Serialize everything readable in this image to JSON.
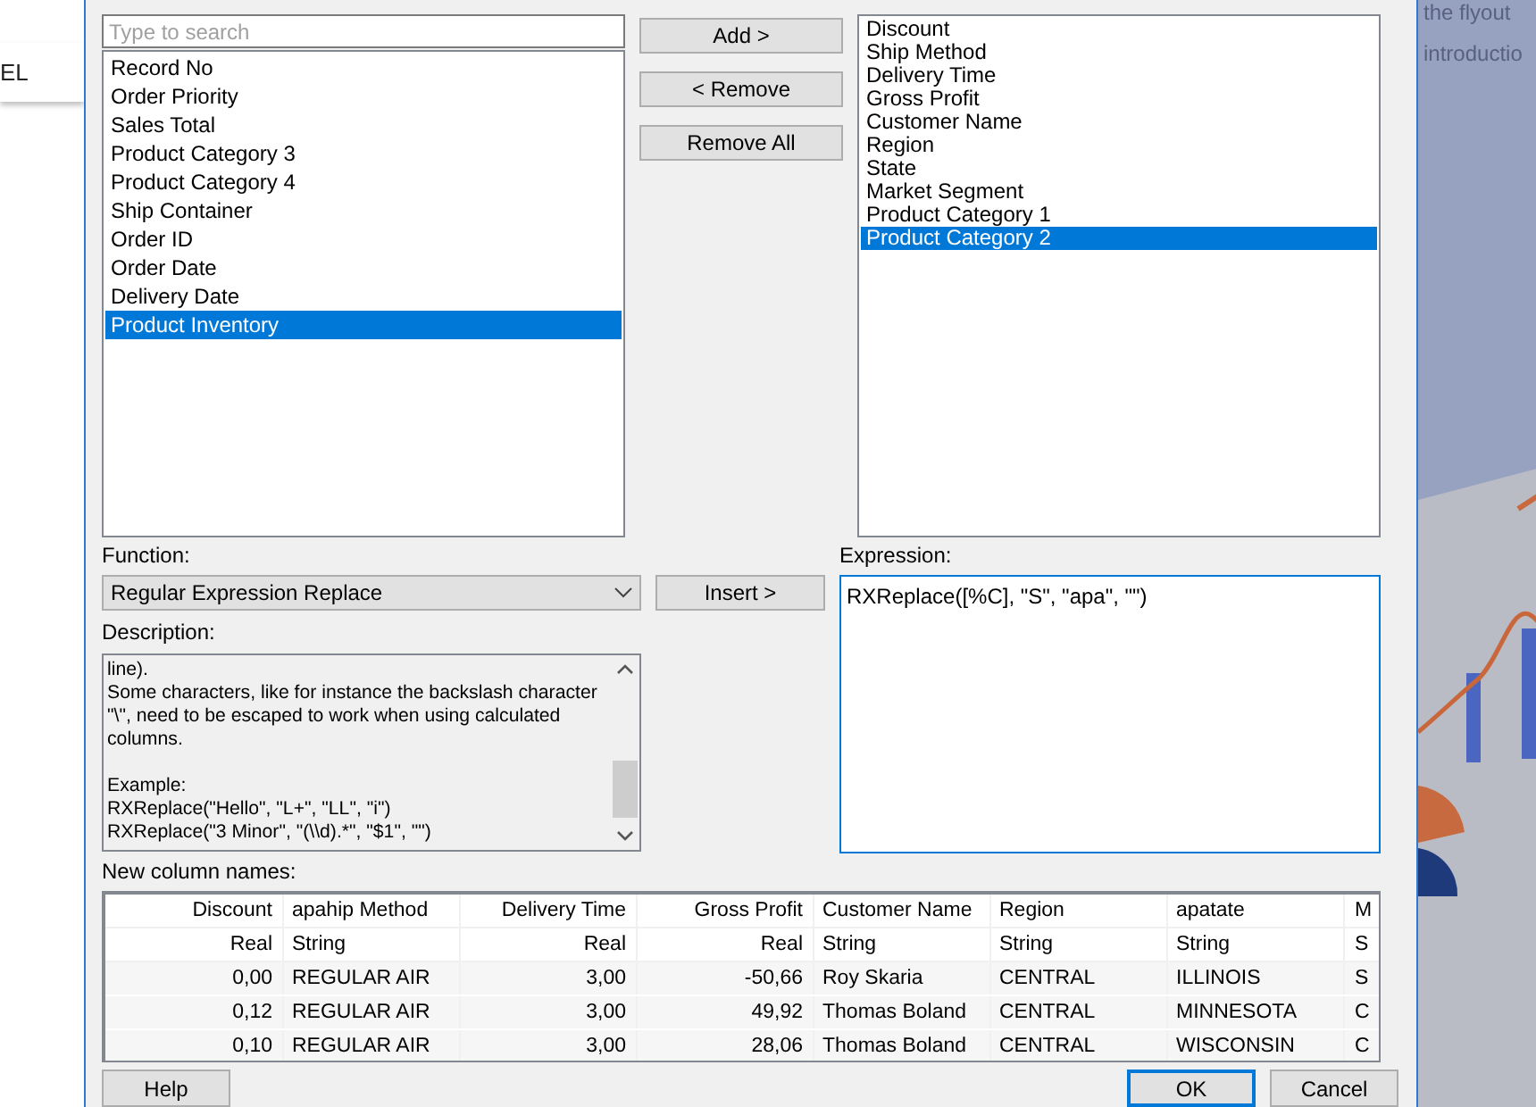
{
  "background_left": {
    "label": "EL"
  },
  "background_right": {
    "lines": [
      "the flyout",
      "introductio"
    ]
  },
  "available_columns": {
    "search": {
      "placeholder": "Type to search"
    },
    "items": [
      {
        "label": "Record No",
        "selected": false
      },
      {
        "label": "Order Priority",
        "selected": false
      },
      {
        "label": "Sales Total",
        "selected": false
      },
      {
        "label": "Product Category 3",
        "selected": false
      },
      {
        "label": "Product Category 4",
        "selected": false
      },
      {
        "label": "Ship Container",
        "selected": false
      },
      {
        "label": "Order ID",
        "selected": false
      },
      {
        "label": "Order Date",
        "selected": false
      },
      {
        "label": "Delivery Date",
        "selected": false
      },
      {
        "label": "Product Inventory",
        "selected": true
      }
    ]
  },
  "move_buttons": [
    "Add >",
    "< Remove",
    "Remove All"
  ],
  "columns_to_rename": {
    "items": [
      {
        "label": "Discount",
        "selected": false
      },
      {
        "label": "Ship Method",
        "selected": false
      },
      {
        "label": "Delivery Time",
        "selected": false
      },
      {
        "label": "Gross Profit",
        "selected": false
      },
      {
        "label": "Customer Name",
        "selected": false
      },
      {
        "label": "Region",
        "selected": false
      },
      {
        "label": "State",
        "selected": false
      },
      {
        "label": "Market Segment",
        "selected": false
      },
      {
        "label": "Product Category 1",
        "selected": false
      },
      {
        "label": "Product Category 2",
        "selected": true
      }
    ]
  },
  "function": {
    "label": "Function:",
    "value": "Regular Expression Replace"
  },
  "insert_button": "Insert >",
  "description": {
    "label": "Description:",
    "text": "line).\nSome characters, like for instance the backslash character\n\"\\\", need to be escaped to work when using calculated\ncolumns.\n\nExample:\nRXReplace(\"Hello\", \"L+\", \"LL\", \"i\")\nRXReplace(\"3 Minor\", \"(\\\\d).*\", \"$1\", \"\")"
  },
  "expression": {
    "label": "Expression:",
    "value": "RXReplace([%C], \"S\", \"apa\", \"\")"
  },
  "new_column_names": {
    "label": "New column names:",
    "columns": [
      {
        "name": "Discount",
        "type": "Real",
        "numeric": true
      },
      {
        "name": "apahip Method",
        "type": "String",
        "numeric": false
      },
      {
        "name": "Delivery Time",
        "type": "Real",
        "numeric": true
      },
      {
        "name": "Gross Profit",
        "type": "Real",
        "numeric": true
      },
      {
        "name": "Customer Name",
        "type": "String",
        "numeric": false
      },
      {
        "name": "Region",
        "type": "String",
        "numeric": false
      },
      {
        "name": "apatate",
        "type": "String",
        "numeric": false
      },
      {
        "name": "M",
        "type": "S",
        "numeric": false
      }
    ],
    "rows": [
      [
        "0,00",
        "REGULAR AIR",
        "3,00",
        "-50,66",
        "Roy Skaria",
        "CENTRAL",
        "ILLINOIS",
        "S"
      ],
      [
        "0,12",
        "REGULAR AIR",
        "3,00",
        "49,92",
        "Thomas Boland",
        "CENTRAL",
        "MINNESOTA",
        "C"
      ],
      [
        "0,10",
        "REGULAR AIR",
        "3,00",
        "28,06",
        "Thomas Boland",
        "CENTRAL",
        "WISCONSIN",
        "C"
      ]
    ]
  },
  "footer_buttons": [
    {
      "label": "Help",
      "default": false
    },
    {
      "label": "OK",
      "default": true
    },
    {
      "label": "Cancel",
      "default": false
    }
  ]
}
